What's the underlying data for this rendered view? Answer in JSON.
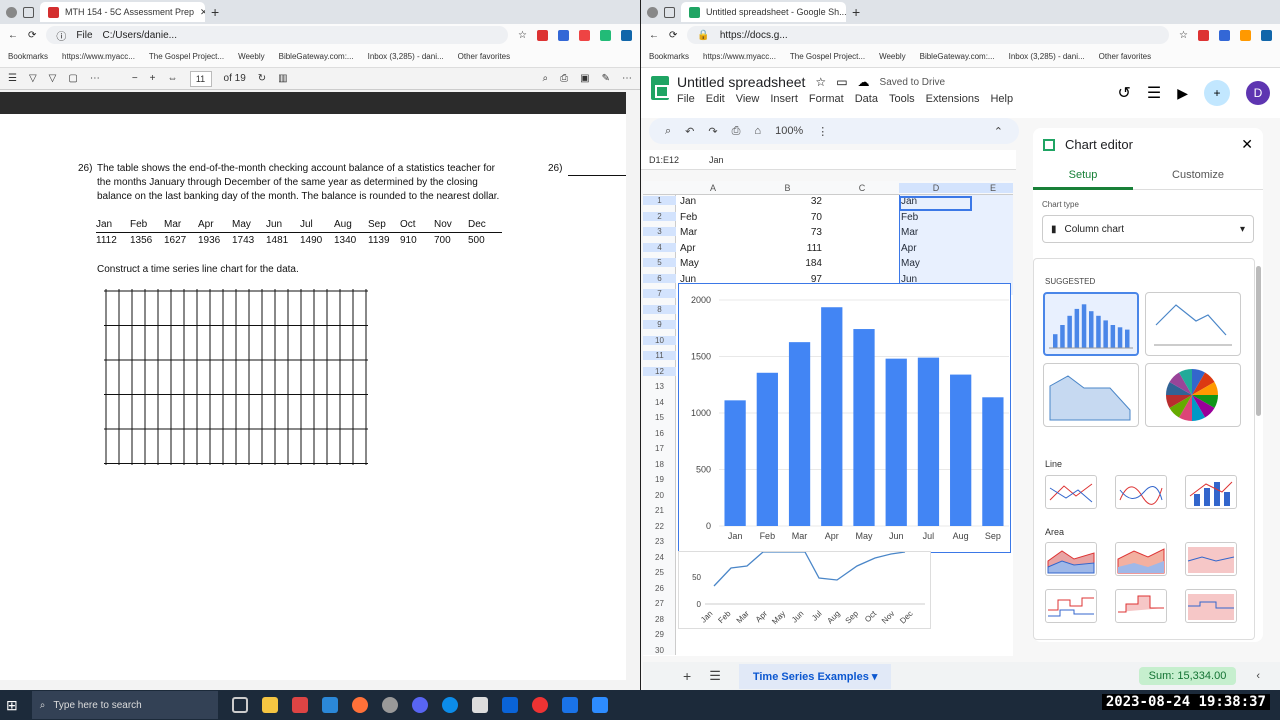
{
  "left_window": {
    "tab_title": "MTH 154 - 5C Assessment Prep",
    "address": "C:/Users/danie...",
    "file_label": "File",
    "bookmarks": [
      "Bookmarks",
      "https://www.myacc...",
      "The Gospel Project...",
      "Weebly",
      "BibleGateway.com:...",
      "Inbox (3,285) - dani...",
      "Other favorites"
    ],
    "page_current": "11",
    "page_total": "of 19"
  },
  "pdf": {
    "q_num": "26)",
    "q_text1": "The table shows the end-of-the-month checking account balance of a statistics teacher for",
    "q_text2": "the months January through December of the same year as determined by the closing",
    "q_text3": "balance on the last banking day of the month.  The balance is rounded to the nearest dollar.",
    "answer_num": "26)",
    "months": [
      "Jan",
      "Feb",
      "Mar",
      "Apr",
      "May",
      "Jun",
      "Jul",
      "Aug",
      "Sep",
      "Oct",
      "Nov",
      "Dec"
    ],
    "balances": [
      "1112",
      "1356",
      "1627",
      "1936",
      "1743",
      "1481",
      "1490",
      "1340",
      "1139",
      "910",
      "700",
      "500"
    ],
    "instruction": "Construct a time series line chart for the data."
  },
  "right_window": {
    "tab_title": "Untitled spreadsheet - Google Sh...",
    "address": "https://docs.g...",
    "bookmarks": [
      "Bookmarks",
      "https://www.myacc...",
      "The Gospel Project...",
      "Weebly",
      "BibleGateway.com:...",
      "Inbox (3,285) - dani...",
      "Other favorites"
    ]
  },
  "sheets": {
    "doc_title": "Untitled spreadsheet",
    "saved": "Saved to Drive",
    "menus": [
      "File",
      "Edit",
      "View",
      "Insert",
      "Format",
      "Data",
      "Tools",
      "Extensions",
      "Help"
    ],
    "zoom": "100%",
    "avatar": "D",
    "name_box": "D1:E12",
    "formula": "Jan",
    "columns": [
      "A",
      "B",
      "C",
      "D",
      "E"
    ],
    "rows": [
      "1",
      "2",
      "3",
      "4",
      "5",
      "6",
      "7",
      "8",
      "9",
      "10",
      "11",
      "12",
      "13",
      "14",
      "15",
      "16",
      "17",
      "18",
      "19",
      "20",
      "21",
      "22",
      "23",
      "24",
      "25",
      "26",
      "27",
      "28",
      "29",
      "30"
    ],
    "a_col": [
      "Jan",
      "Feb",
      "Mar",
      "Apr",
      "May",
      "Jun"
    ],
    "b_col": [
      "32",
      "70",
      "73",
      "111",
      "184",
      "97"
    ],
    "d_col": [
      "Jan",
      "Feb",
      "Mar",
      "Apr",
      "May",
      "Jun"
    ],
    "sheet_tab": "Time Series Examples",
    "sum": "Sum: 15,334.00"
  },
  "chart_data": [
    {
      "type": "bar",
      "categories": [
        "Jan",
        "Feb",
        "Mar",
        "Apr",
        "May",
        "Jun",
        "Jul",
        "Aug",
        "Sep"
      ],
      "values": [
        1112,
        1356,
        1627,
        1936,
        1743,
        1481,
        1490,
        1340,
        1139
      ],
      "ylim": [
        0,
        2000
      ],
      "yticks": [
        "0",
        "500",
        "1000",
        "1500",
        "2000"
      ],
      "color": "#4285f4"
    },
    {
      "type": "line",
      "categories": [
        "Jan",
        "Feb",
        "Mar",
        "Apr",
        "May",
        "Jun",
        "Jul",
        "Aug",
        "Sep",
        "Oct",
        "Nov",
        "Dec"
      ],
      "yticks": [
        "0",
        "50"
      ],
      "color": "#4a86c8"
    }
  ],
  "editor": {
    "title": "Chart editor",
    "tab_setup": "Setup",
    "tab_customize": "Customize",
    "chart_type_label": "Chart type",
    "chart_type_value": "Column chart",
    "suggested": "SUGGESTED",
    "line_section": "Line",
    "area_section": "Area"
  },
  "taskbar": {
    "search_placeholder": "Type here to search",
    "clock": "2023-08-24  19:38:37"
  }
}
